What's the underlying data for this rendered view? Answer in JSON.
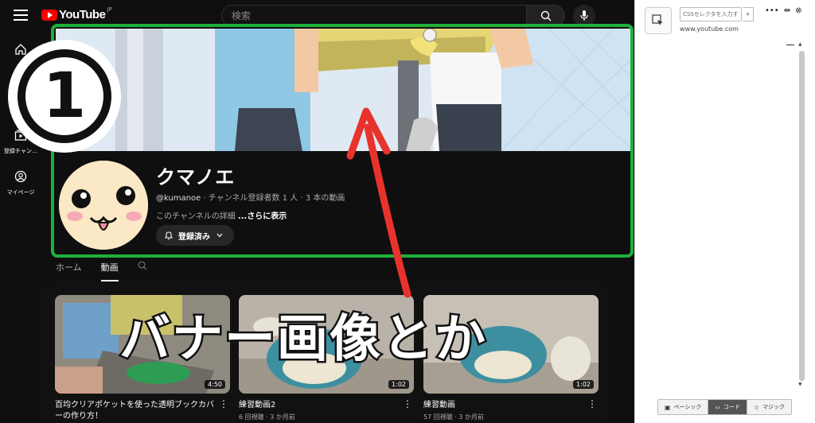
{
  "youtube": {
    "logo_text": "YouTube",
    "logo_region": "JP",
    "search_placeholder": "検索",
    "sidebar": [
      {
        "label": "",
        "icon": "home-icon"
      },
      {
        "label": "登録チャン…",
        "icon": "subscriptions-icon"
      },
      {
        "label": "マイページ",
        "icon": "you-icon"
      }
    ],
    "channel": {
      "name": "クマノエ",
      "handle": "@kumanoe",
      "meta": " · チャンネル登録者数 1 人 · 3 本の動画",
      "description": "このチャンネルの詳細 ",
      "more": "...さらに表示",
      "subscribe_label": "登録済み"
    },
    "tabs": [
      "ホーム",
      "動画"
    ],
    "videos": [
      {
        "title": "百均クリアポケットを使った透明ブックカバーの作り方！",
        "meta": "",
        "duration": "4:50"
      },
      {
        "title": "練習動画2",
        "meta": "6 回視聴 · 3 か月前",
        "duration": "1:02"
      },
      {
        "title": "練習動画",
        "meta": "57 回視聴 · 3 か月前",
        "duration": "1:02"
      }
    ]
  },
  "annotation": {
    "number": "①",
    "caption": "バナー画像とか",
    "frame_color": "#1db13a",
    "arrow_color": "#e8332c"
  },
  "extension": {
    "css_placeholder": "CSSセレクタを入力す",
    "dropdown": "▾",
    "url": "www.youtube.com",
    "modes": [
      "ベーシック",
      "コード",
      "マジック"
    ],
    "active_mode": "コード"
  }
}
